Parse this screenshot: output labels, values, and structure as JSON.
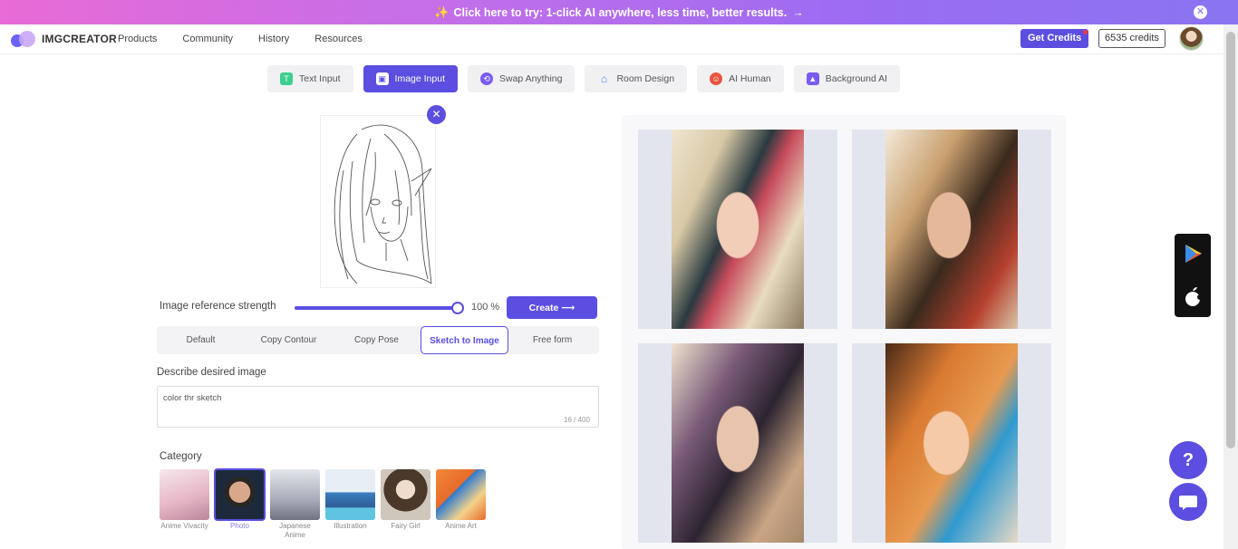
{
  "banner": {
    "text": "Click here to try: 1-click AI anywhere, less time, better results.",
    "arrow": "→",
    "close": "✕"
  },
  "nav": {
    "logo": "IMGCREATOR",
    "links": [
      "Products",
      "Community",
      "History",
      "Resources"
    ],
    "get_credits": "Get Credits",
    "credits": "6535 credits"
  },
  "tabs": [
    {
      "label": "Text Input",
      "icon": "text-input-icon",
      "color": "#3ecf8e"
    },
    {
      "label": "Image Input",
      "icon": "image-input-icon",
      "color": "#ffffff"
    },
    {
      "label": "Swap Anything",
      "icon": "swap-icon",
      "color": "#7a5cf0"
    },
    {
      "label": "Room Design",
      "icon": "house-icon",
      "color": "#3a8df0"
    },
    {
      "label": "AI Human",
      "icon": "human-icon",
      "color": "#e8553e"
    },
    {
      "label": "Background AI",
      "icon": "background-icon",
      "color": "#7a5cf0"
    }
  ],
  "controls": {
    "strength_label": "Image reference strength",
    "strength_value": "100 %",
    "strength_fraction": 1.0,
    "create": "Create ⟶",
    "modes": [
      "Default",
      "Copy Contour",
      "Copy Pose",
      "Sketch to Image",
      "Free form"
    ],
    "active_mode": "Sketch to Image",
    "desc_label": "Describe desired image",
    "desc_value": "color thr sketch",
    "desc_count": "16 / 400",
    "category_label": "Category"
  },
  "categories": [
    {
      "label": "Anime Vivacity",
      "colors": [
        "#f3dde4",
        "#d8a6b8"
      ]
    },
    {
      "label": "Photo",
      "colors": [
        "#1d2a3a",
        "#c99a7e"
      ]
    },
    {
      "label": "Japanese Anime",
      "colors": [
        "#d9dce4",
        "#7c7f8c"
      ]
    },
    {
      "label": "Illustration",
      "colors": [
        "#5ec4e0",
        "#e3edf4"
      ]
    },
    {
      "label": "Fairy Girl",
      "colors": [
        "#d8cfc4",
        "#5a4636"
      ]
    },
    {
      "label": "Anime Art",
      "colors": [
        "#e86a2a",
        "#2f7bd0"
      ]
    }
  ],
  "accent": "#5b4ee0"
}
